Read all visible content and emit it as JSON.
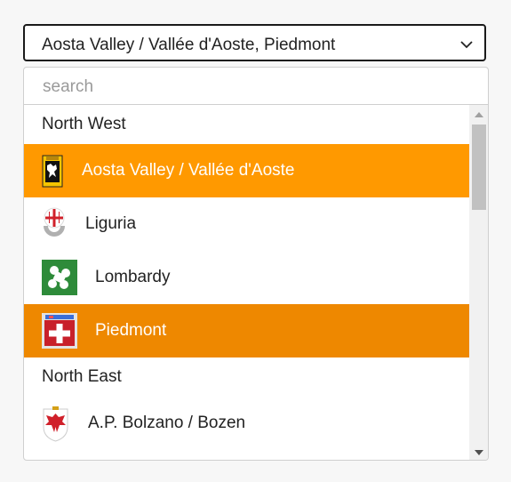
{
  "select": {
    "value": "Aosta Valley / Vallée d'Aoste, Piedmont",
    "chevron_icon": "chevron-down-icon"
  },
  "search": {
    "placeholder": "search"
  },
  "groups": [
    {
      "label": "North West",
      "options": [
        {
          "label": "Aosta Valley / Vallée d'Aoste",
          "icon": "aosta-valley-flag-icon",
          "state": "highlighted"
        },
        {
          "label": "Liguria",
          "icon": "liguria-flag-icon",
          "state": "normal"
        },
        {
          "label": "Lombardy",
          "icon": "lombardy-flag-icon",
          "state": "normal"
        },
        {
          "label": "Piedmont",
          "icon": "piedmont-flag-icon",
          "state": "selected"
        }
      ]
    },
    {
      "label": "North East",
      "options": [
        {
          "label": "A.P. Bolzano / Bozen",
          "icon": "bolzano-coat-of-arms-icon",
          "state": "normal"
        }
      ]
    }
  ],
  "colors": {
    "highlight": "#ff9900",
    "selected": "#ee8800",
    "lombardy_green": "#2e8b3a"
  }
}
